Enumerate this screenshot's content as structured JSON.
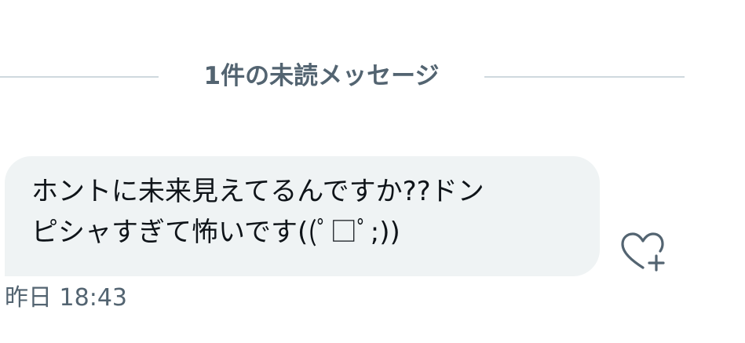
{
  "unread_divider": {
    "label": "1件の未読メッセージ"
  },
  "message": {
    "text": "ホントに未来見えてるんですか??ドン\nピシャすぎて怖いです((ﾟ□ﾟ;))",
    "timestamp": "昨日 18:43",
    "reaction_icon": "heart-plus-icon"
  },
  "colors": {
    "bubble_background": "#eff3f4",
    "text_primary": "#0f1419",
    "text_secondary": "#536471",
    "divider_line": "#cfd9de"
  }
}
